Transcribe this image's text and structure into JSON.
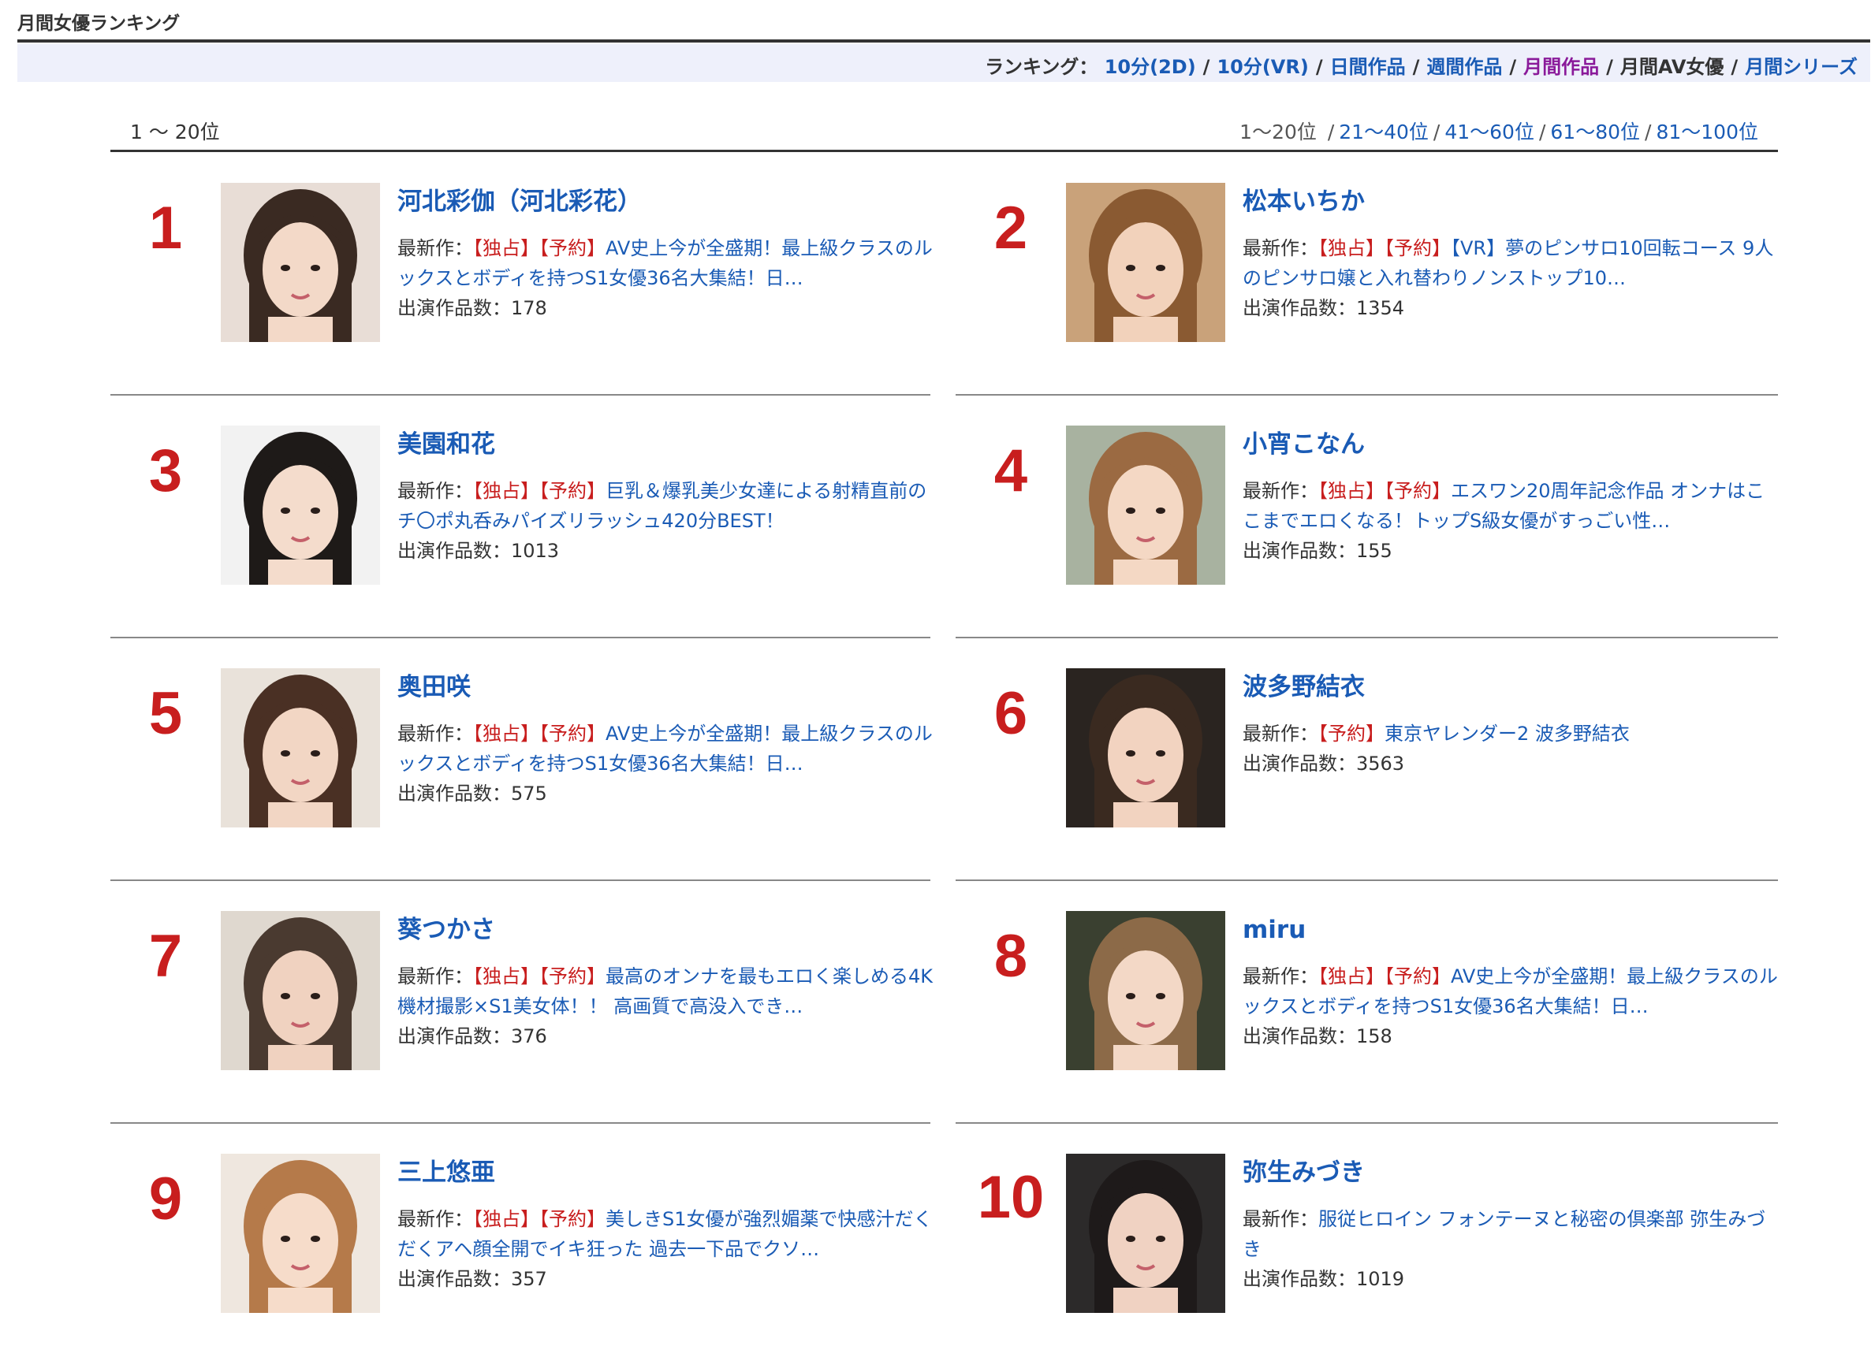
{
  "page": {
    "title": "月間女優ランキング",
    "nav": {
      "label": "ランキング：",
      "items": [
        {
          "label": "10分(2D)",
          "state": "link"
        },
        {
          "label": "10分(VR)",
          "state": "link"
        },
        {
          "label": "日間作品",
          "state": "link"
        },
        {
          "label": "週間作品",
          "state": "link"
        },
        {
          "label": "月間作品",
          "state": "visited"
        },
        {
          "label": "月間AV女優",
          "state": "current"
        },
        {
          "label": "月間シリーズ",
          "state": "link"
        }
      ]
    },
    "range_label": "1 〜 20位",
    "pager": {
      "current": "1〜20位",
      "links": [
        "21〜40位",
        "41〜60位",
        "61〜80位",
        "81〜100位"
      ]
    },
    "labels": {
      "latest_prefix": "最新作：",
      "count_prefix": "出演作品数："
    },
    "colors": {
      "link": "#1a5bb5",
      "rank": "#c81e1e",
      "tag": "#c81e1e",
      "nav_bg": "#eef0fb"
    }
  },
  "actresses": [
    {
      "rank": "1",
      "name": "河北彩伽（河北彩花）",
      "tags": [
        "【独占】",
        "【予約】"
      ],
      "work": "AV史上今が全盛期！最上級クラスのルックスとボディを持つS1女優36名大集結！日…",
      "count": "178"
    },
    {
      "rank": "2",
      "name": "松本いちか",
      "tags": [
        "【独占】",
        "【予約】"
      ],
      "work": "【VR】夢のピンサロ10回転コース 9人のピンサロ嬢と入れ替わりノンストップ10…",
      "count": "1354"
    },
    {
      "rank": "3",
      "name": "美園和花",
      "tags": [
        "【独占】",
        "【予約】"
      ],
      "work": "巨乳＆爆乳美少女達による射精直前のチ〇ポ丸呑みパイズリラッシュ420分BEST！",
      "count": "1013"
    },
    {
      "rank": "4",
      "name": "小宵こなん",
      "tags": [
        "【独占】",
        "【予約】"
      ],
      "work": "エスワン20周年記念作品 オンナはここまでエロくなる！トップS級女優がすっごい性…",
      "count": "155"
    },
    {
      "rank": "5",
      "name": "奥田咲",
      "tags": [
        "【独占】",
        "【予約】"
      ],
      "work": "AV史上今が全盛期！最上級クラスのルックスとボディを持つS1女優36名大集結！日…",
      "count": "575"
    },
    {
      "rank": "6",
      "name": "波多野結衣",
      "tags": [
        "【予約】"
      ],
      "work": "東京ヤレンダー2 波多野結衣",
      "count": "3563"
    },
    {
      "rank": "7",
      "name": "葵つかさ",
      "tags": [
        "【独占】",
        "【予約】"
      ],
      "work": "最高のオンナを最もエロく楽しめる4K機材撮影×S1美女体！！ 高画質で高没入でき…",
      "count": "376"
    },
    {
      "rank": "8",
      "name": "miru",
      "tags": [
        "【独占】",
        "【予約】"
      ],
      "work": "AV史上今が全盛期！最上級クラスのルックスとボディを持つS1女優36名大集結！日…",
      "count": "158"
    },
    {
      "rank": "9",
      "name": "三上悠亜",
      "tags": [
        "【独占】",
        "【予約】"
      ],
      "work": "美しきS1女優が強烈媚薬で快感汁だくだくアヘ顔全開でイキ狂った 過去一下品でクソ…",
      "count": "357"
    },
    {
      "rank": "10",
      "name": "弥生みづき",
      "tags": [],
      "work": "服従ヒロイン フォンテーヌと秘密の倶楽部 弥生みづき",
      "count": "1019"
    }
  ]
}
